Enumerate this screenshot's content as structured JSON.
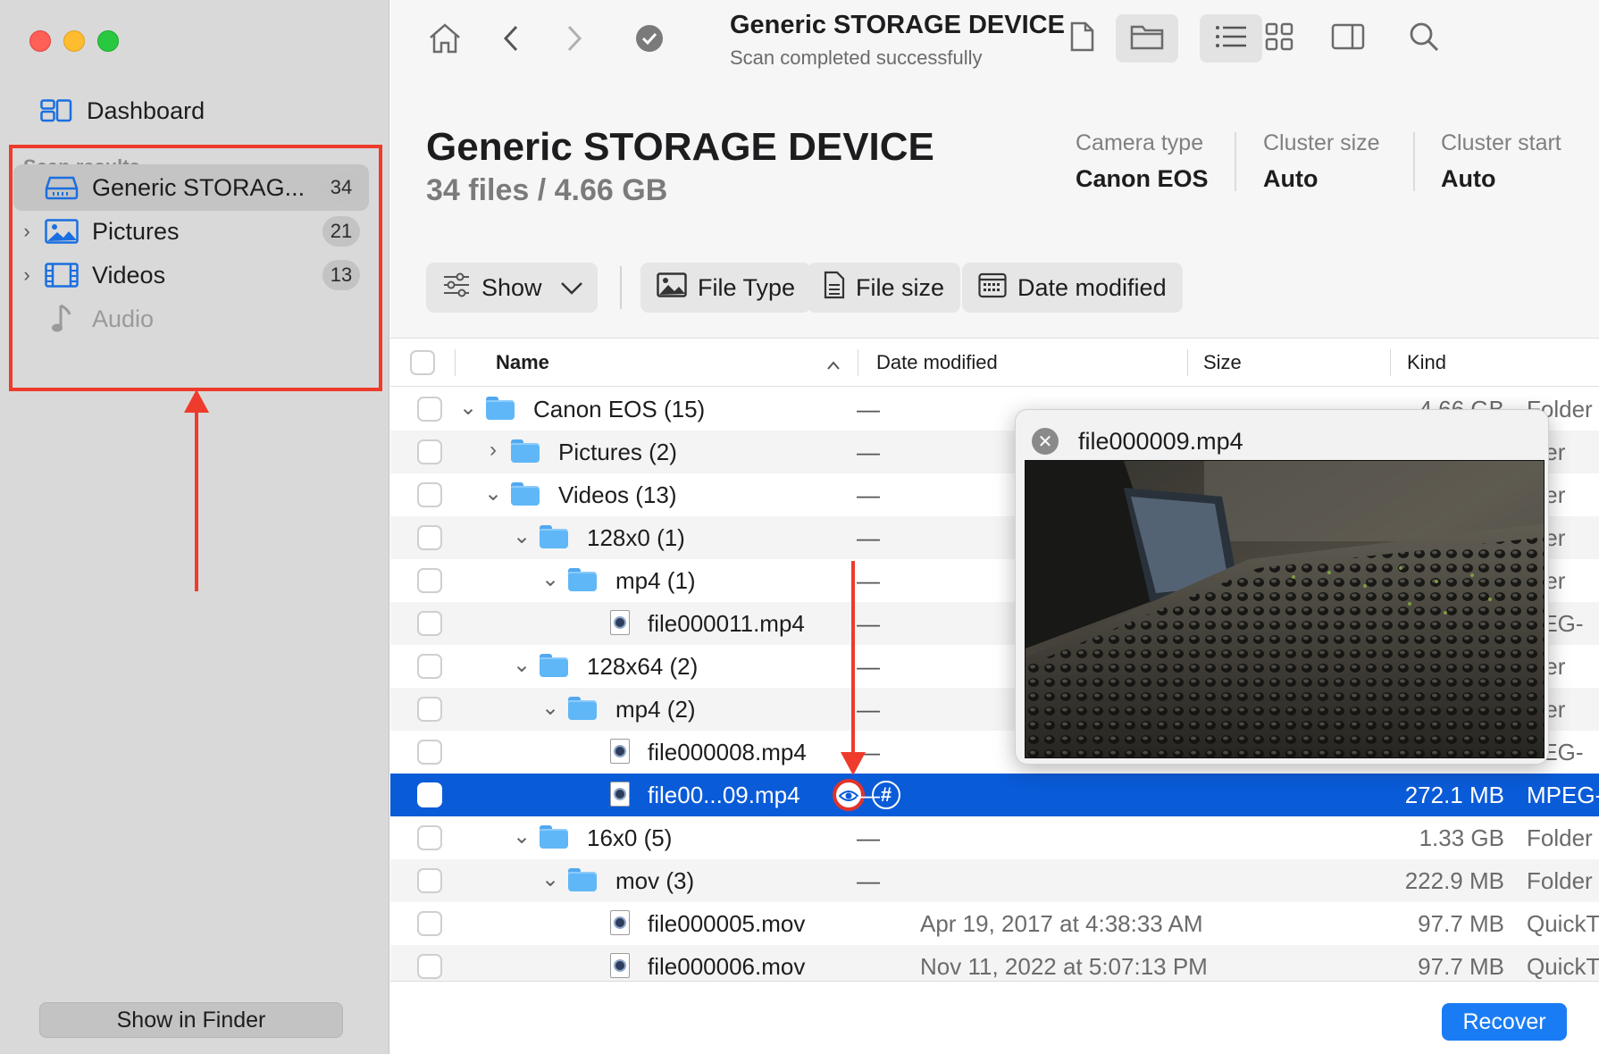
{
  "sidebar": {
    "dashboard_label": "Dashboard",
    "section_label": "Scan results",
    "items": [
      {
        "label": "Generic STORAG...",
        "count": "34"
      },
      {
        "label": "Pictures",
        "count": "21"
      },
      {
        "label": "Videos",
        "count": "13"
      },
      {
        "label": "Audio",
        "count": ""
      }
    ],
    "show_in_finder": "Show in Finder"
  },
  "toolbar": {
    "title": "Generic STORAGE DEVICE",
    "subtitle": "Scan completed successfully"
  },
  "header": {
    "title": "Generic STORAGE DEVICE",
    "summary": "34 files / 4.66 GB",
    "meta": [
      {
        "label": "Camera type",
        "value": "Canon EOS"
      },
      {
        "label": "Cluster size",
        "value": "Auto"
      },
      {
        "label": "Cluster start",
        "value": "Auto"
      }
    ],
    "filters": {
      "show": "Show",
      "file_type": "File Type",
      "file_size": "File size",
      "date_modified": "Date modified"
    }
  },
  "table": {
    "columns": {
      "name": "Name",
      "date": "Date modified",
      "size": "Size",
      "kind": "Kind"
    },
    "rows": [
      {
        "name": "Canon EOS (15)",
        "date": "—",
        "size": "4.66 GB",
        "kind": "Folder"
      },
      {
        "name": "Pictures (2)",
        "date": "—",
        "size": "",
        "kind": "lder"
      },
      {
        "name": "Videos (13)",
        "date": "—",
        "size": "",
        "kind": "lder"
      },
      {
        "name": "128x0 (1)",
        "date": "—",
        "size": "",
        "kind": "lder"
      },
      {
        "name": "mp4 (1)",
        "date": "—",
        "size": "",
        "kind": "lder"
      },
      {
        "name": "file000011.mp4",
        "date": "—",
        "size": "",
        "kind": "PEG-"
      },
      {
        "name": "128x64 (2)",
        "date": "—",
        "size": "",
        "kind": "lder"
      },
      {
        "name": "mp4 (2)",
        "date": "—",
        "size": "",
        "kind": "lder"
      },
      {
        "name": "file000008.mp4",
        "date": "—",
        "size": "",
        "kind": "PEG-"
      },
      {
        "name": "file00...09.mp4",
        "date": "—",
        "size": "272.1 MB",
        "kind": "MPEG-"
      },
      {
        "name": "16x0 (5)",
        "date": "—",
        "size": "1.33 GB",
        "kind": "Folder"
      },
      {
        "name": "mov (3)",
        "date": "—",
        "size": "222.9 MB",
        "kind": "Folder"
      },
      {
        "name": "file000005.mov",
        "date": "Apr 19, 2017 at 4:38:33 AM",
        "size": "97.7 MB",
        "kind": "QuickT"
      },
      {
        "name": "file000006.mov",
        "date": "Nov 11, 2022 at 5:07:13 PM",
        "size": "97.7 MB",
        "kind": "QuickT"
      }
    ],
    "hash_symbol": "#"
  },
  "preview": {
    "title": "file000009.mp4",
    "close_symbol": "✕"
  },
  "footer": {
    "recover": "Recover"
  },
  "colors": {
    "accent": "#1a7cf5",
    "selection": "#0a5bd8",
    "annotation": "#ee3b2b"
  }
}
